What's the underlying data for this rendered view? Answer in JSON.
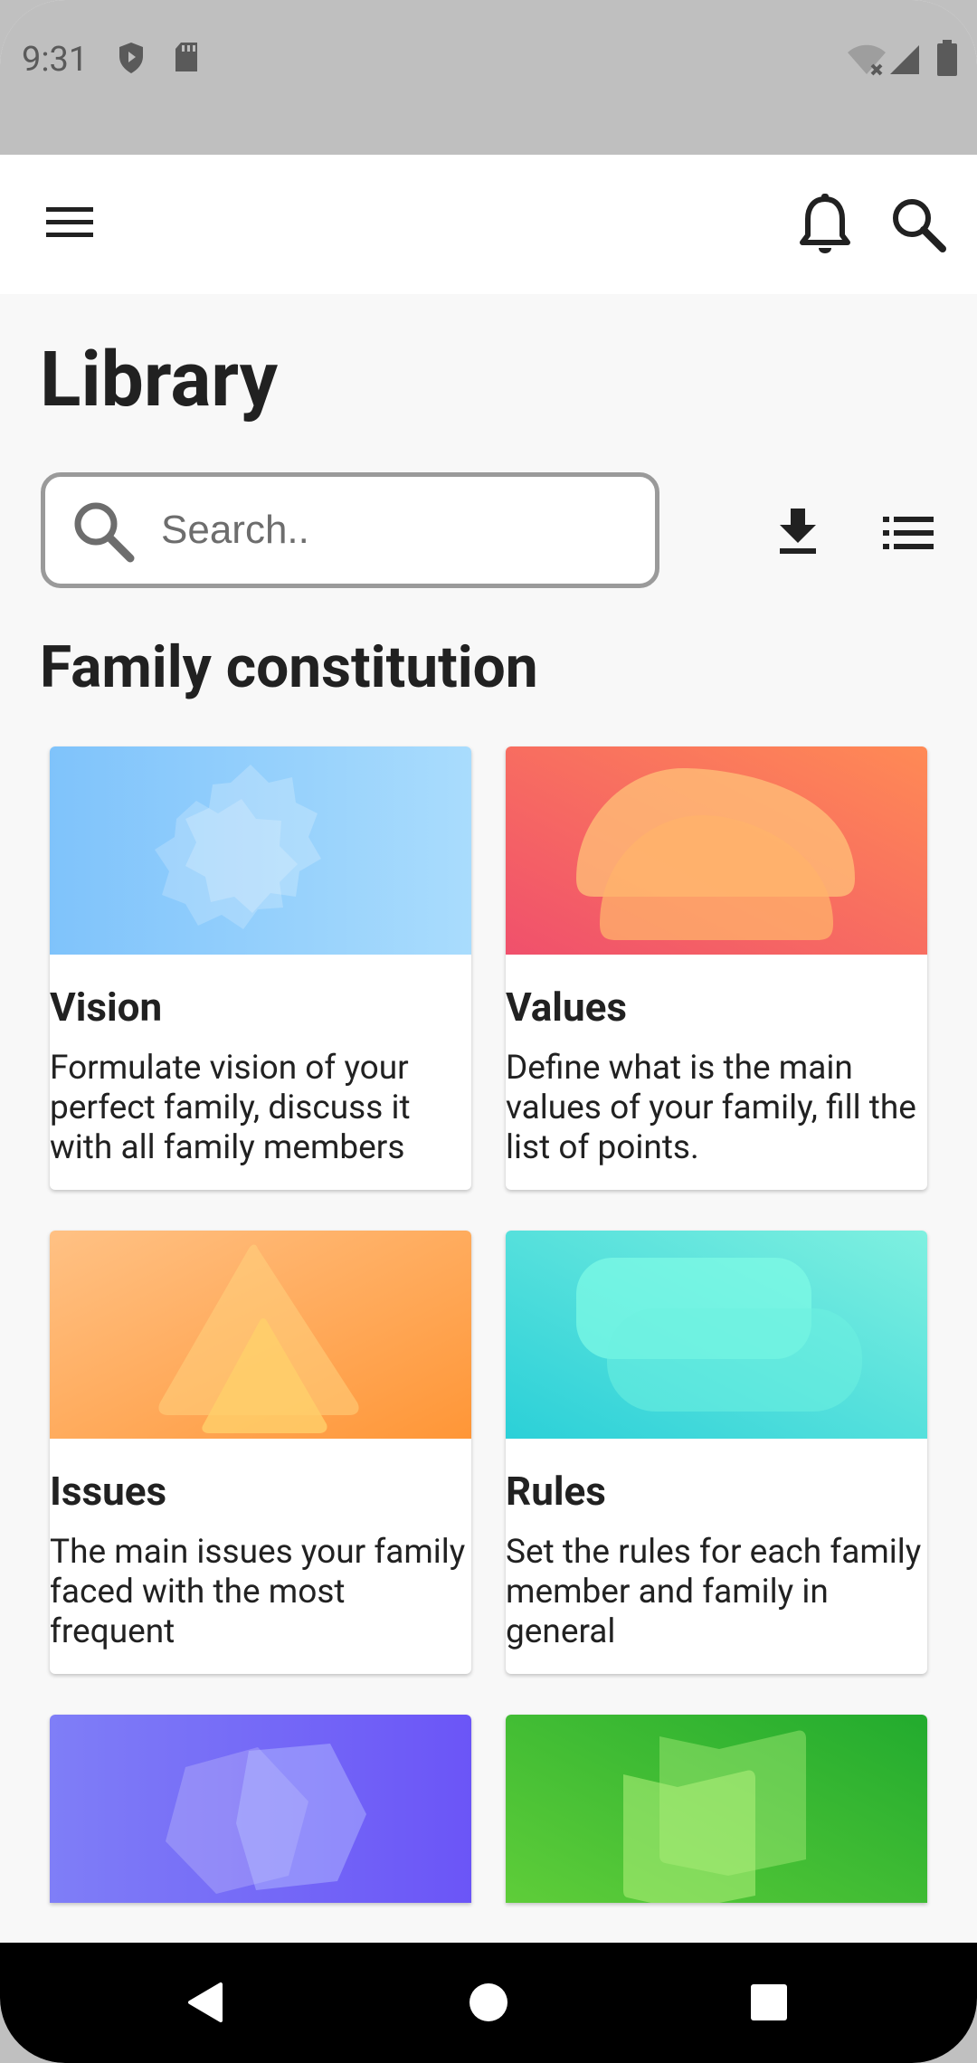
{
  "status_bar": {
    "time": "9:31",
    "left_icons": [
      "shield-icon",
      "sd-card-icon"
    ],
    "right_icons": [
      "wifi-off-icon",
      "signal-icon",
      "battery-icon"
    ]
  },
  "app_bar": {
    "icons": [
      "menu-icon",
      "bell-icon",
      "search-icon"
    ]
  },
  "page": {
    "title": "Library"
  },
  "search": {
    "placeholder": "Search..",
    "value": ""
  },
  "toolbar": {
    "icons": [
      "download-icon",
      "list-view-icon"
    ]
  },
  "section": {
    "title": "Family constitution"
  },
  "cards": [
    {
      "title": "Vision",
      "description": "Formulate vision of your perfect family, discuss it with all family members",
      "gradient": [
        "#7fc3fb",
        "#a9dcfd"
      ]
    },
    {
      "title": "Values",
      "description": "Define what is the main values of your family, fill the list of points.",
      "gradient": [
        "#f0506c",
        "#ff8a55"
      ]
    },
    {
      "title": "Issues",
      "description": "The main issues your family faced with the most frequent",
      "gradient": [
        "#ffc184",
        "#ff9637"
      ]
    },
    {
      "title": "Rules",
      "description": "Set the rules for each family member and family in general",
      "gradient": [
        "#2bd0d8",
        "#7ff0e0"
      ]
    },
    {
      "title": "",
      "description": "",
      "gradient": [
        "#7f7ef7",
        "#6b55f7"
      ]
    },
    {
      "title": "",
      "description": "",
      "gradient": [
        "#62cf3a",
        "#22ab2e"
      ]
    }
  ],
  "colors": {
    "status_bar": "#bfbfbf",
    "background": "#f8f8f8",
    "text": "#212121",
    "nav_bar": "#000000"
  },
  "nav_bar": {
    "buttons": [
      "back-icon",
      "home-icon",
      "recents-icon"
    ]
  }
}
